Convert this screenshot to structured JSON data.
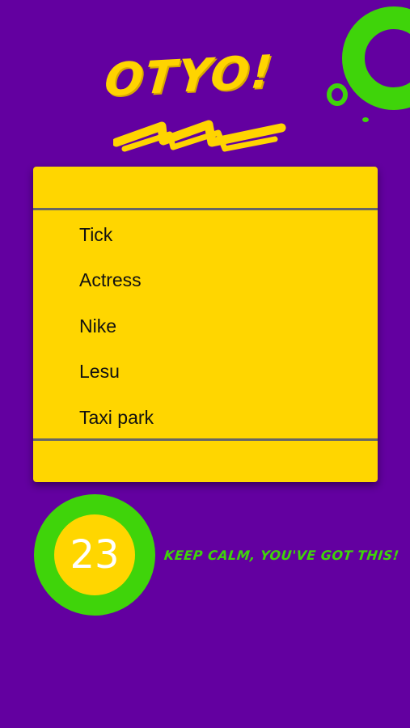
{
  "app": {
    "logo": "OTYO!"
  },
  "words": [
    "Tick",
    "Actress",
    "Nike",
    "Lesu",
    "Taxi park"
  ],
  "timer": {
    "value": "23"
  },
  "motto": "KEEP CALM, YOU'VE GOT THIS!",
  "colors": {
    "background": "#6300a0",
    "accent_yellow": "#ffd600",
    "accent_green": "#3fd40a",
    "divider": "#666666"
  }
}
